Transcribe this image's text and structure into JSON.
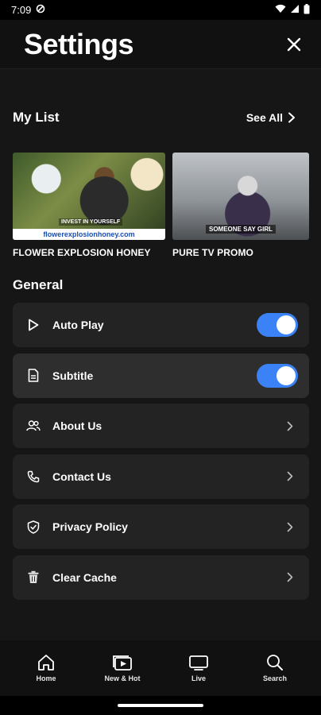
{
  "status_bar": {
    "time": "7:09"
  },
  "header": {
    "title": "Settings"
  },
  "my_list": {
    "title": "My List",
    "see_all": "See All",
    "items": [
      {
        "title": "FLOWER EXPLOSION HONEY",
        "overlay_tag": "INVEST IN YOURSELF",
        "overlay_caption": "flowerexplosionhoney.com"
      },
      {
        "title": "PURE TV PROMO",
        "overlay_tag": "SOMEONE SAY GIRL"
      }
    ]
  },
  "general": {
    "title": "General",
    "items": [
      {
        "label": "Auto Play",
        "icon": "play-icon",
        "type": "toggle",
        "enabled": true
      },
      {
        "label": "Subtitle",
        "icon": "document-icon",
        "type": "toggle",
        "enabled": true
      },
      {
        "label": "About Us",
        "icon": "users-icon",
        "type": "link"
      },
      {
        "label": "Contact Us",
        "icon": "phone-icon",
        "type": "link"
      },
      {
        "label": "Privacy Policy",
        "icon": "shield-icon",
        "type": "link"
      },
      {
        "label": "Clear Cache",
        "icon": "trash-icon",
        "type": "link"
      }
    ]
  },
  "bottom_nav": {
    "items": [
      {
        "label": "Home",
        "icon": "home-icon"
      },
      {
        "label": "New & Hot",
        "icon": "play-library-icon"
      },
      {
        "label": "Live",
        "icon": "tv-icon"
      },
      {
        "label": "Search",
        "icon": "search-icon"
      }
    ]
  },
  "colors": {
    "background": "#161616",
    "row": "#232323",
    "accent": "#3b82f6"
  }
}
